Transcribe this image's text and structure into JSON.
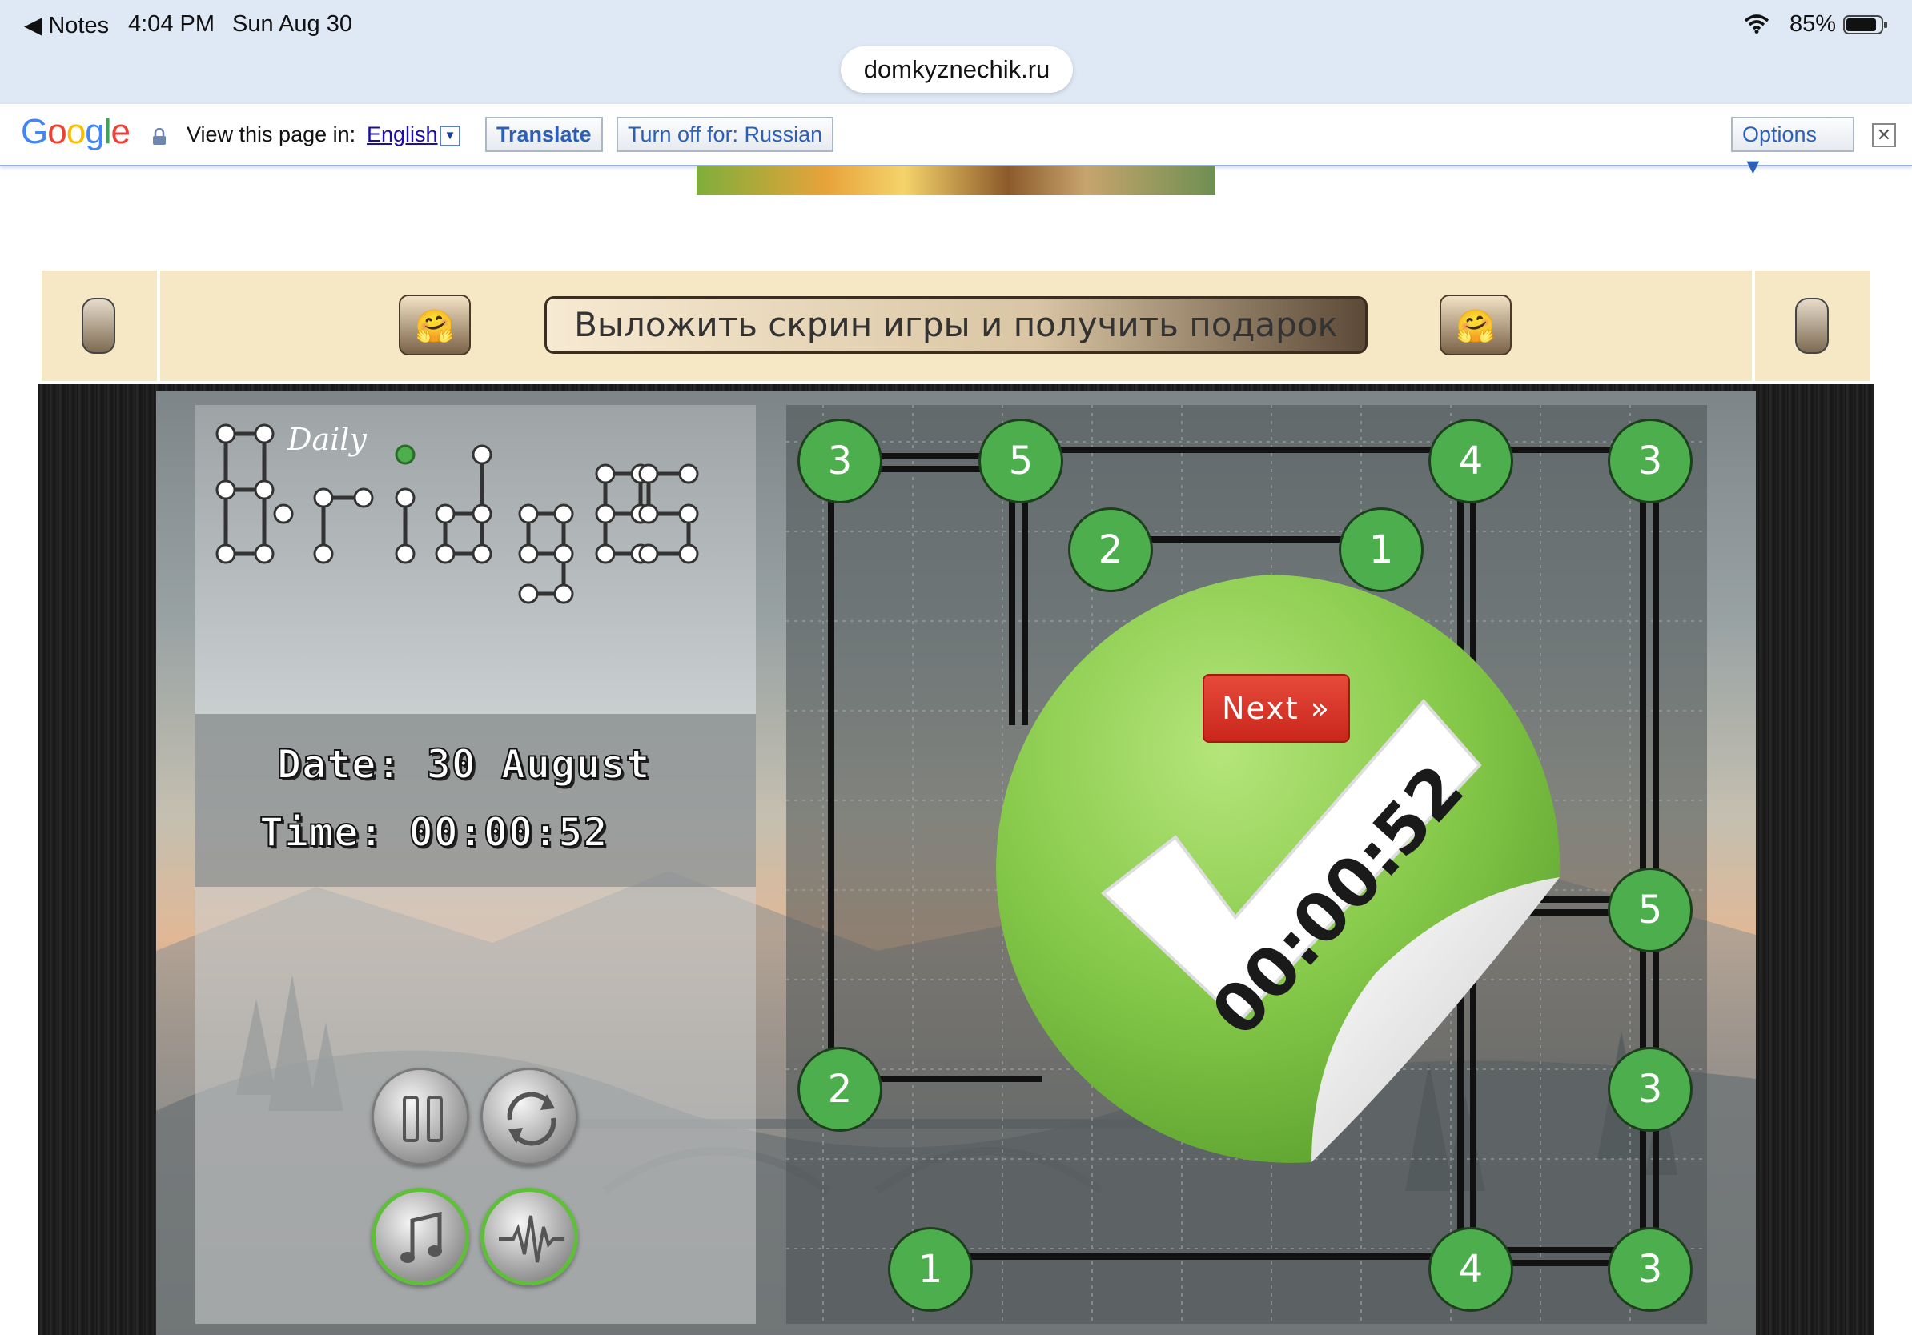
{
  "status_bar": {
    "back_app": "◀ Notes",
    "time": "4:04 PM",
    "date": "Sun Aug 30",
    "battery_percent": "85%"
  },
  "url_bar": {
    "domain": "domkyznechik.ru"
  },
  "translate_bar": {
    "logo": [
      "G",
      "o",
      "o",
      "g",
      "l",
      "e"
    ],
    "view_label": "View this page in:",
    "language": "English",
    "dropdown_glyph": "▼",
    "translate_label": "Translate",
    "turn_off_label": "Turn off for: Russian",
    "options_label": "Options ▼",
    "close_glyph": "✕"
  },
  "promo": {
    "button_label": "Выложить скрин игры и получить подарок",
    "emoji": "🤗"
  },
  "game": {
    "logo_script": "Daily",
    "logo_title": "Bridges",
    "date_text": "Date: 30 August",
    "time_text": "Time: 00:00:52",
    "controls": [
      {
        "name": "pause-button",
        "icon": "pause-icon",
        "active": false
      },
      {
        "name": "restart-button",
        "icon": "restart-icon",
        "active": false
      },
      {
        "name": "music-button",
        "icon": "music-note-icon",
        "active": true
      },
      {
        "name": "sound-button",
        "icon": "sound-wave-icon",
        "active": true
      }
    ],
    "nodes": [
      "3",
      "5",
      "4",
      "3",
      "2",
      "1",
      "5",
      "2",
      "3",
      "1",
      "4",
      "3"
    ],
    "result": {
      "next_label": "Next »",
      "elapsed": "00:00:52"
    }
  },
  "colors": {
    "node_green": "#4cae4c",
    "next_red": "#d8342a",
    "sticker_green": "#8fd14f",
    "promo_bg": "#f7e8c5"
  }
}
